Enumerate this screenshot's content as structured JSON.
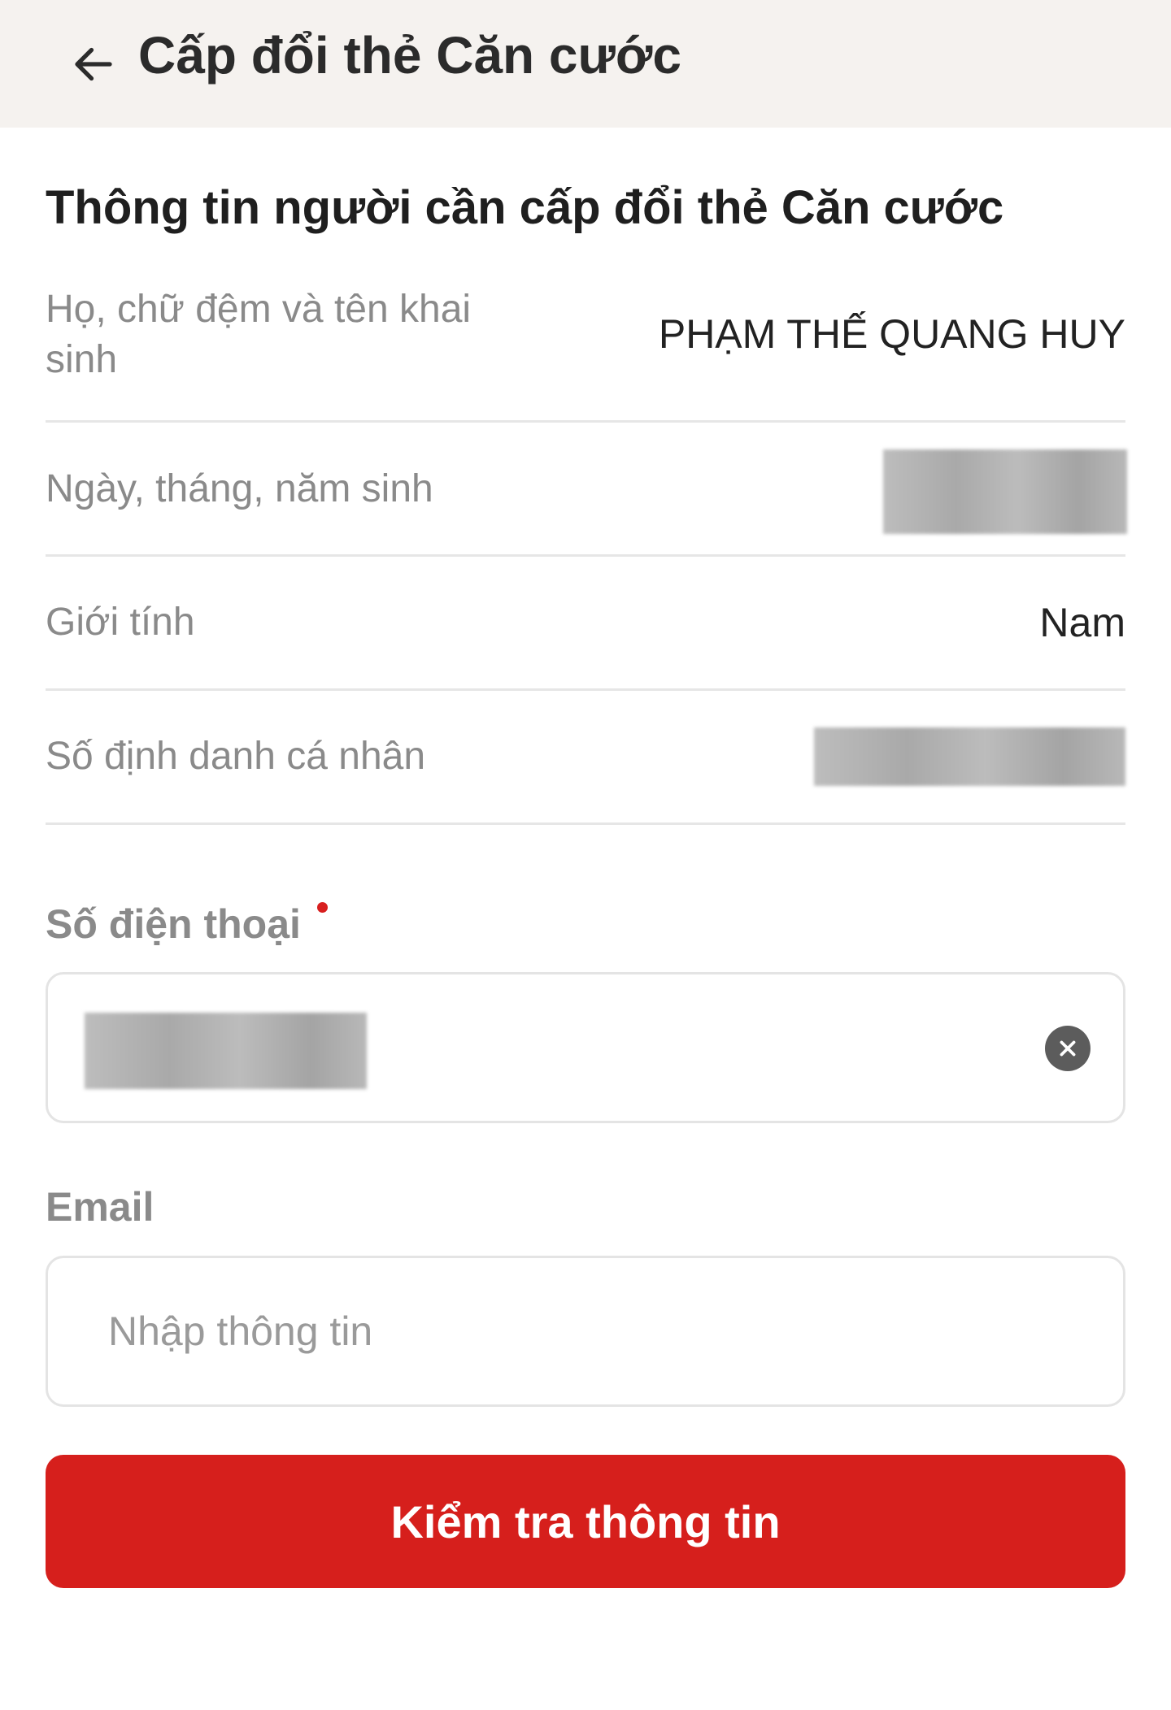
{
  "header": {
    "title": "Cấp đổi thẻ Căn cước",
    "back_icon": "arrow-left-icon"
  },
  "section": {
    "title": "Thông tin người cần cấp đổi thẻ Căn cước"
  },
  "info_rows": [
    {
      "label": "Họ, chữ đệm và tên khai sinh",
      "value": "PHẠM THẾ QUANG HUY"
    },
    {
      "label": "Ngày, tháng, năm sinh",
      "value": ""
    },
    {
      "label": "Giới tính",
      "value": "Nam"
    },
    {
      "label": "Số định danh cá nhân",
      "value": ""
    }
  ],
  "phone": {
    "label": "Số điện thoại",
    "value": "",
    "clear_icon": "clear-circle-icon"
  },
  "email": {
    "label": "Email",
    "placeholder": "Nhập thông tin",
    "value": ""
  },
  "submit": {
    "label": "Kiểm tra thông tin"
  },
  "colors": {
    "header_bg": "#f5f2ef",
    "primary": "#d61f1c",
    "required": "#d81f1f"
  }
}
